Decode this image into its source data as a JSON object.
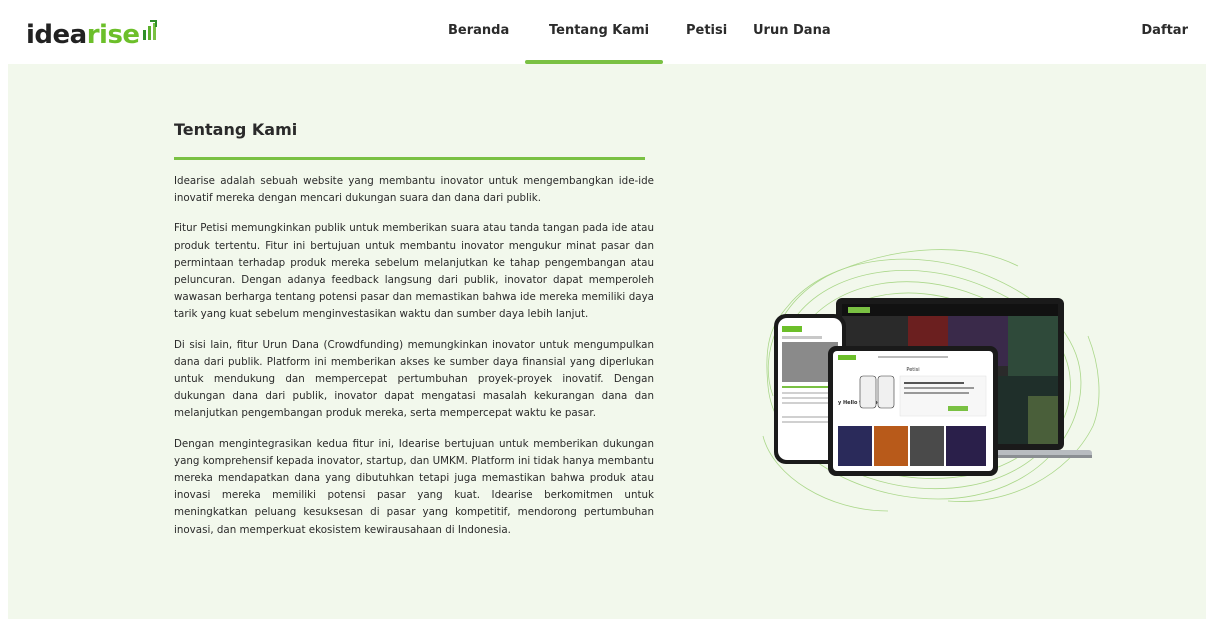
{
  "brand": {
    "part1": "idea",
    "part2": "rise"
  },
  "nav": {
    "items": [
      {
        "label": "Beranda"
      },
      {
        "label": "Tentang Kami"
      },
      {
        "label": "Petisi"
      },
      {
        "label": "Urun Dana"
      }
    ],
    "active": "Tentang Kami",
    "signup": "Daftar"
  },
  "about": {
    "title": "Tentang Kami",
    "paragraphs": [
      "Idearise adalah sebuah website yang membantu inovator untuk mengembangkan ide-ide inovatif mereka dengan mencari dukungan suara dan dana dari publik.",
      "Fitur Petisi memungkinkan publik untuk memberikan suara atau tanda tangan pada ide atau produk tertentu. Fitur ini bertujuan untuk membantu inovator mengukur minat pasar dan permintaan terhadap produk mereka sebelum melanjutkan ke tahap pengembangan atau peluncuran. Dengan adanya feedback langsung dari publik, inovator dapat memperoleh wawasan berharga tentang potensi pasar dan memastikan bahwa ide mereka memiliki daya tarik yang kuat sebelum menginvestasikan waktu dan sumber daya lebih lanjut.",
      "Di sisi lain, fitur Urun Dana (Crowdfunding) memungkinkan inovator untuk mengumpulkan dana dari publik. Platform ini memberikan akses ke sumber daya finansial yang diperlukan untuk mendukung dan mempercepat pertumbuhan proyek-proyek inovatif. Dengan dukungan dana dari publik, inovator dapat mengatasi masalah kekurangan dana dan melanjutkan pengembangan produk mereka, serta mempercepat waktu ke pasar.",
      "Dengan mengintegrasikan kedua fitur ini, Idearise bertujuan untuk memberikan dukungan yang komprehensif kepada inovator, startup, dan UMKM. Platform ini tidak hanya membantu mereka mendapatkan dana yang dibutuhkan tetapi juga memastikan bahwa produk atau inovasi mereka memiliki potensi pasar yang kuat. Idearise berkomitmen untuk meningkatkan peluang kesuksesan di pasar yang kompetitif, mendorong pertumbuhan inovasi, dan memperkuat ekosistem kewirausahaan di Indonesia."
    ]
  },
  "illustration": {
    "tablet_heading": "Petisi",
    "tablet_greeting": "y Hello to Anoney"
  },
  "colors": {
    "accent": "#7ac143",
    "brand_green": "#6cbf2a",
    "panel_bg": "#f2f8ec",
    "text": "#2b2b2b"
  }
}
